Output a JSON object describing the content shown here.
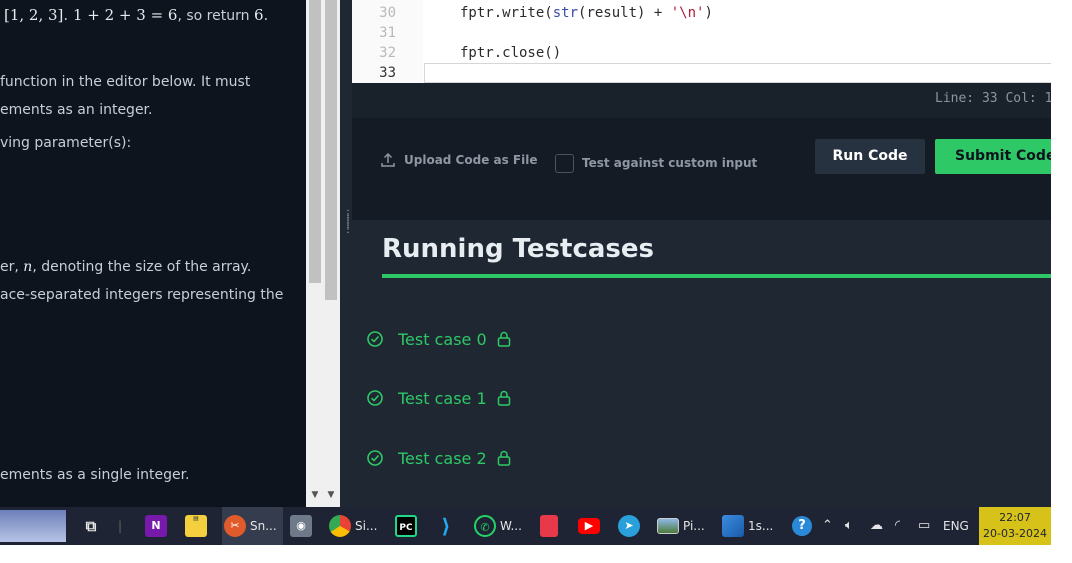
{
  "problem": {
    "line1_math": "[1, 2, 3]",
    "line1_sep": ". ",
    "line1_eq": "1 + 2 + 3 = 6",
    "line1_tail": ", so return ",
    "line1_val": "6",
    "line1_end": ".",
    "line2": " function in the editor below. It must",
    "line3": "ements as an integer.",
    "line4": "ving parameter(s):",
    "line5_pre": "er, ",
    "line5_var": "n",
    "line5_post": ", denoting the size of the array.",
    "line6": "ace-separated integers representing the",
    "line7": "ements as a single integer."
  },
  "editor": {
    "lines": [
      {
        "num": "30",
        "code": "fptr.write(str(result) + '\\n')"
      },
      {
        "num": "31",
        "code": ""
      },
      {
        "num": "32",
        "code": "fptr.close()"
      },
      {
        "num": "33",
        "code": ""
      }
    ],
    "code_parts": {
      "write_pre": "fptr.write(",
      "write_fn": "str",
      "write_mid": "(result) + ",
      "write_str": "'\\n'",
      "write_end": ")"
    },
    "status": "Line: 33 Col: 1"
  },
  "actions": {
    "upload_label": "Upload Code as File",
    "custom_input_label": "Test against custom input",
    "run_label": "Run Code",
    "submit_label": "Submit Code"
  },
  "results": {
    "title": "Running Testcases",
    "testcases": [
      {
        "label": "Test case 0"
      },
      {
        "label": "Test case 1"
      },
      {
        "label": "Test case 2"
      }
    ]
  },
  "taskbar": {
    "items": [
      {
        "label": "Sn..."
      },
      {
        "label": "Si..."
      },
      {
        "label": "W..."
      },
      {
        "label": "Pi..."
      },
      {
        "label": "1s..."
      }
    ],
    "language": "ENG",
    "time": "22:07",
    "date": "20-03-2024"
  },
  "colors": {
    "accent_green": "#2ec866",
    "panel_dark": "#0e141e",
    "results_bg": "#1f2732"
  }
}
